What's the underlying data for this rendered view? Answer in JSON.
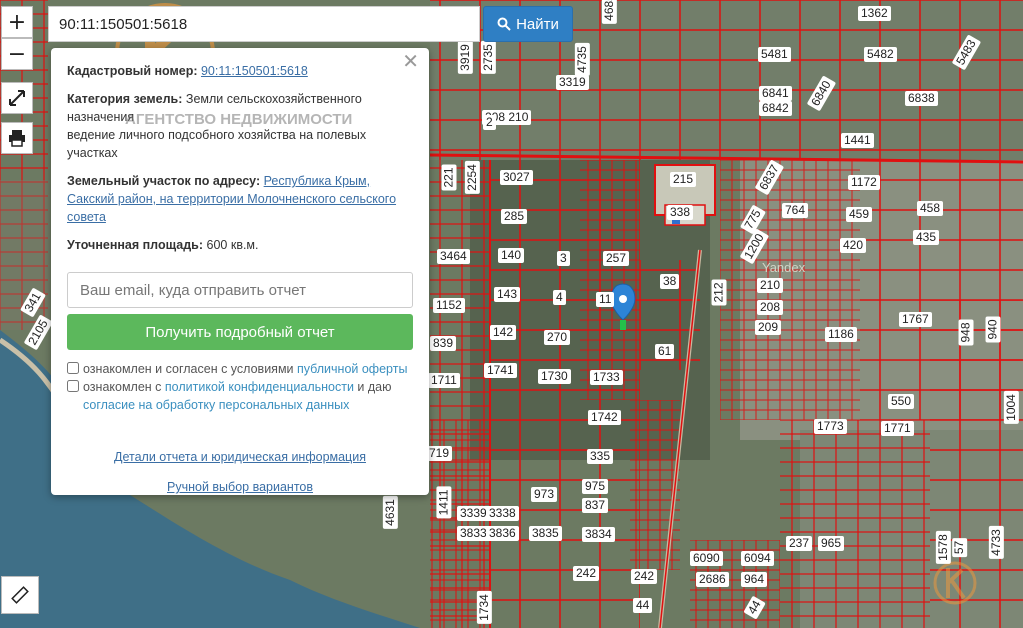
{
  "search": {
    "value": "90:11:150501:5618",
    "button_label": "Найти"
  },
  "controls": {
    "zoom_in": "+",
    "zoom_out": "−"
  },
  "watermark": "АГЕНТСТВО НЕДВИЖИМОСТИ",
  "popup": {
    "cadastral_label": "Кадастровый номер:",
    "cadastral_value": "90:11:150501:5618",
    "category_label": "Категория земель:",
    "category_value": "Земли сельскохозяйственного назначения",
    "use_value": "ведение личного подсобного хозяйства на полевых участках",
    "address_label": "Земельный участок по адресу:",
    "address_value": "Республика Крым, Сакский район, на территории Молочненского сельского совета",
    "area_label": "Уточненная площадь:",
    "area_value": "600 кв.м.",
    "email_placeholder": "Ваш email, куда отправить отчет",
    "report_button": "Получить подробный отчет",
    "agree1_text": "ознакомлен и согласен с условиями ",
    "agree1_link": "публичной оферты",
    "agree2_text": "ознакомлен с ",
    "agree2_link": "политикой конфиденциальности",
    "agree2_text2": " и даю",
    "agree2_link2": "согласие на обработку персональных данных",
    "details_link": "Детали отчета и юридическая информация",
    "manual_link": "Ручной выбор вариантов"
  },
  "map_text": {
    "yandex": "Yandex"
  },
  "parcels": [
    {
      "t": "1362"
    },
    {
      "t": "5481"
    },
    {
      "t": "5482"
    },
    {
      "t": "5483"
    },
    {
      "t": "6841"
    },
    {
      "t": "6840"
    },
    {
      "t": "6838"
    },
    {
      "t": "6842"
    },
    {
      "t": "1441"
    },
    {
      "t": "3027"
    },
    {
      "t": "215"
    },
    {
      "t": "6837"
    },
    {
      "t": "1172"
    },
    {
      "t": "285"
    },
    {
      "t": "338"
    },
    {
      "t": "775"
    },
    {
      "t": "764"
    },
    {
      "t": "459"
    },
    {
      "t": "458"
    },
    {
      "t": "435"
    },
    {
      "t": "3464"
    },
    {
      "t": "140"
    },
    {
      "t": "3"
    },
    {
      "t": "257"
    },
    {
      "t": "1200"
    },
    {
      "t": "420"
    },
    {
      "t": "143"
    },
    {
      "t": "4"
    },
    {
      "t": "11"
    },
    {
      "t": "38"
    },
    {
      "t": "210"
    },
    {
      "t": "1152"
    },
    {
      "t": "208"
    },
    {
      "t": "1767"
    },
    {
      "t": "142"
    },
    {
      "t": "270"
    },
    {
      "t": "209"
    },
    {
      "t": "1186"
    },
    {
      "t": "839"
    },
    {
      "t": "61"
    },
    {
      "t": "948"
    },
    {
      "t": "940"
    },
    {
      "t": "1741"
    },
    {
      "t": "1730"
    },
    {
      "t": "1733"
    },
    {
      "t": "1711"
    },
    {
      "t": "1742"
    },
    {
      "t": "550"
    },
    {
      "t": "1004"
    },
    {
      "t": "1773"
    },
    {
      "t": "1771"
    },
    {
      "t": "719"
    },
    {
      "t": "335"
    },
    {
      "t": "973"
    },
    {
      "t": "975"
    },
    {
      "t": "837"
    },
    {
      "t": "3339"
    },
    {
      "t": "3338"
    },
    {
      "t": "3833"
    },
    {
      "t": "3836"
    },
    {
      "t": "3835"
    },
    {
      "t": "3834"
    },
    {
      "t": "237"
    },
    {
      "t": "965"
    },
    {
      "t": "6090"
    },
    {
      "t": "6094"
    },
    {
      "t": "242"
    },
    {
      "t": "242"
    },
    {
      "t": "2686"
    },
    {
      "t": "964"
    },
    {
      "t": "44"
    },
    {
      "t": "44"
    },
    {
      "t": "1578"
    },
    {
      "t": "57"
    },
    {
      "t": "4733"
    },
    {
      "t": "1411"
    },
    {
      "t": "4631"
    },
    {
      "t": "1734"
    },
    {
      "t": "341"
    },
    {
      "t": "2105"
    },
    {
      "t": "221"
    },
    {
      "t": "2254"
    },
    {
      "t": "3919"
    },
    {
      "t": "2735"
    },
    {
      "t": "4735"
    },
    {
      "t": "4685"
    },
    {
      "t": "212"
    },
    {
      "t": "3319"
    },
    {
      "t": "208 210"
    },
    {
      "t": "2"
    },
    {
      "t": "1"
    },
    {
      "t": "1"
    }
  ]
}
